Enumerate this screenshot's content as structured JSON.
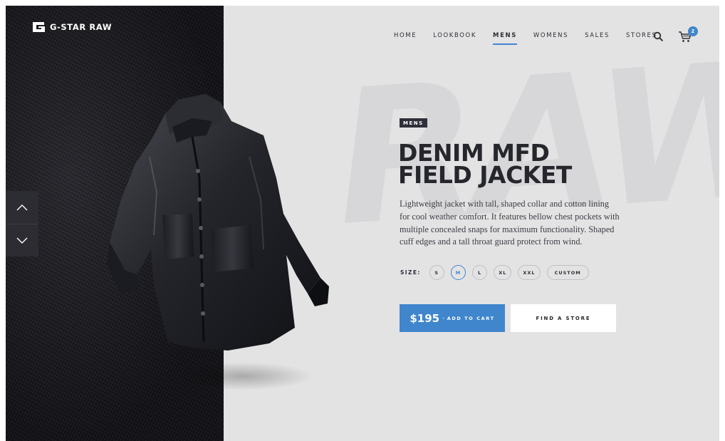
{
  "brand": {
    "name": "G-STAR RAW"
  },
  "nav": {
    "items": [
      {
        "label": "HOME",
        "active": false
      },
      {
        "label": "LOOKBOOK",
        "active": false
      },
      {
        "label": "MENS",
        "active": true
      },
      {
        "label": "WOMENS",
        "active": false
      },
      {
        "label": "SALES",
        "active": false
      },
      {
        "label": "STORES",
        "active": false
      }
    ]
  },
  "header": {
    "search_icon": "search-icon",
    "cart_icon": "cart-icon",
    "cart_count": "2"
  },
  "watermark": "RAW",
  "product": {
    "category": "MENS",
    "title_line1": "DENIM MFD",
    "title_line2": "FIELD JACKET",
    "description": "Lightweight jacket with tall, shaped collar and cotton lining for cool weather comfort. It features bellow chest pockets with multiple concealed snaps for maximum functionality. Shaped cuff edges and a tall throat guard protect from wind.",
    "size_label": "SIZE:",
    "sizes": [
      "S",
      "M",
      "L",
      "XL",
      "XXL",
      "CUSTOM"
    ],
    "selected_size": "M",
    "price": "$195",
    "price_separator": "-",
    "add_to_cart_label": "ADD TO CART",
    "find_store_label": "FIND A STORE"
  },
  "carousel": {
    "up_icon": "chevron-up-icon",
    "down_icon": "chevron-down-icon"
  },
  "colors": {
    "accent": "#3f86cc",
    "dark": "#2e3039",
    "background": "#e4e3e4"
  }
}
